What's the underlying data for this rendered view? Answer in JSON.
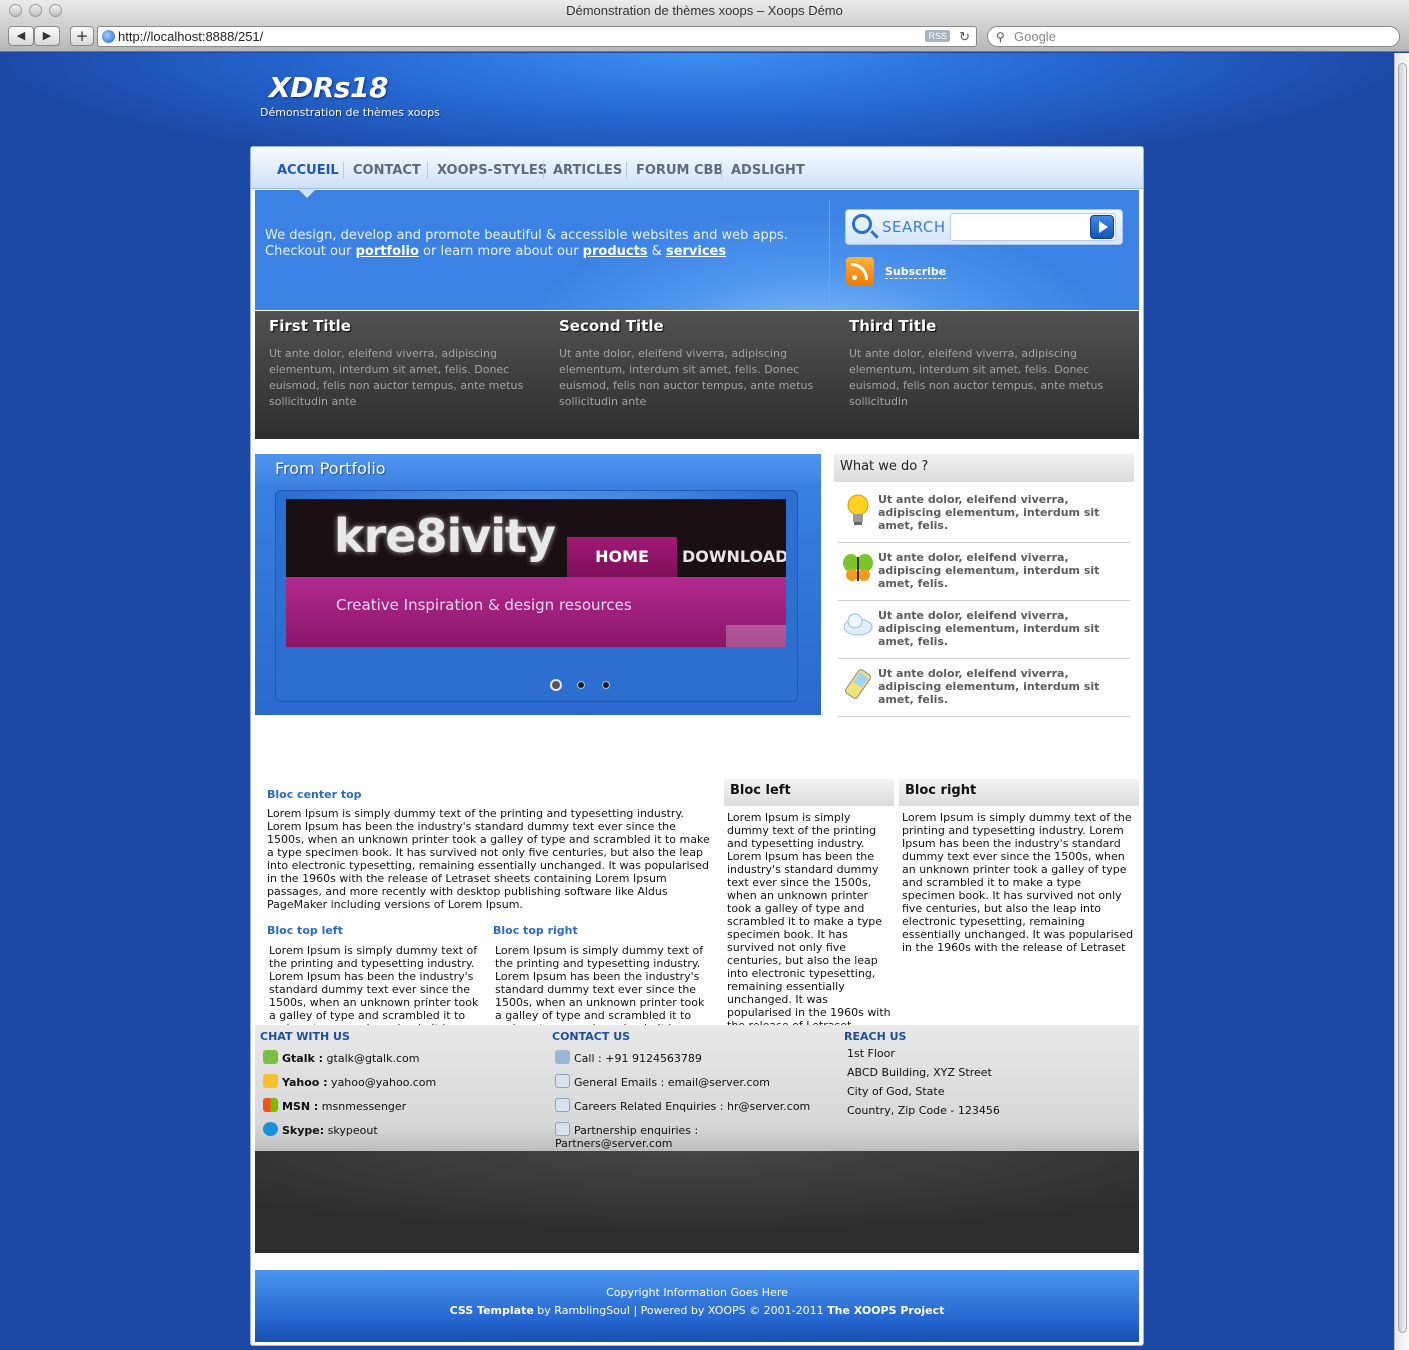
{
  "browser": {
    "title": "Démonstration de thèmes xoops – Xoops Démo",
    "url": "http://localhost:8888/251/",
    "rss": "RSS",
    "search_placeholder": "Google"
  },
  "site": {
    "logo": "XDRs18",
    "slogan": "Démonstration de thèmes xoops"
  },
  "nav": [
    "ACCUEIL",
    "CONTACT",
    "XOOPS-STYLES",
    "ARTICLES",
    "FORUM CBB",
    "ADSLIGHT"
  ],
  "hero": {
    "line1": "We design, develop and promote beautiful & accessible websites and web apps.",
    "line2_a": "Checkout our ",
    "link_portfolio": "portfolio",
    "line2_b": " or learn more about our ",
    "link_products": "products",
    "amp": " & ",
    "link_services": "services",
    "search_label": "SEARCH",
    "subscribe": "Subscribe"
  },
  "band": [
    {
      "title": "First Title",
      "text": "Ut ante dolor, eleifend viverra, adipiscing elementum, interdum sit amet, felis. Donec euismod, felis non auctor tempus, ante metus sollicitudin ante"
    },
    {
      "title": "Second Title",
      "text": "Ut ante dolor, eleifend viverra, adipiscing elementum, interdum sit amet, felis. Donec euismod, felis non auctor tempus, ante metus sollicitudin ante"
    },
    {
      "title": "Third Title",
      "text": "Ut ante dolor, eleifend viverra, adipiscing elementum, interdum sit amet, felis. Donec euismod, felis non auctor tempus, ante metus sollicitudin"
    }
  ],
  "portfolio": {
    "title": "From Portfolio",
    "brand": "kre8ivity",
    "home": "HOME",
    "downloads": "DOWNLOADS",
    "tagline": "Creative Inspiration & design resources"
  },
  "what_we_do": {
    "title": "What we do ?",
    "items": [
      {
        "icon": "lightbulb-icon",
        "text": "Ut ante dolor, eleifend viverra, adipiscing elementum, interdum sit amet, felis."
      },
      {
        "icon": "butterfly-icon",
        "text": "Ut ante dolor, eleifend viverra, adipiscing elementum, interdum sit amet, felis."
      },
      {
        "icon": "cloud-icon",
        "text": "Ut ante dolor, eleifend viverra, adipiscing elementum, interdum sit amet, felis."
      },
      {
        "icon": "phone-icon",
        "text": "Ut ante dolor, eleifend viverra, adipiscing elementum, interdum sit amet, felis."
      }
    ]
  },
  "blocks": {
    "center_top_title": "Bloc center top",
    "center_top_text": "Lorem Ipsum is simply dummy text of the printing and typesetting industry. Lorem Ipsum has been the industry's standard dummy text ever since the 1500s, when an unknown printer took a galley of type and scrambled it to make a type specimen book. It has survived not only five centuries, but also the leap into electronic typesetting, remaining essentially unchanged. It was popularised in the 1960s with the release of Letraset sheets containing Lorem Ipsum passages, and more recently with desktop publishing software like Aldus PageMaker including versions of Lorem Ipsum.",
    "top_left_title": "Bloc top left",
    "top_left_text": "Lorem Ipsum is simply dummy text of the printing and typesetting industry. Lorem Ipsum has been the industry's standard dummy text ever since the 1500s, when an unknown printer took a galley of type and scrambled it to make a type specimen book. It has survived not only five centuries, but also the leap into electronic typesetting, remaining",
    "top_right_title": "Bloc top right",
    "top_right_text": "Lorem Ipsum is simply dummy text of the printing and typesetting industry. Lorem Ipsum has been the industry's standard dummy text ever since the 1500s, when an unknown printer took a galley of type and scrambled it to make a type specimen book. It has survived not only five centuries,",
    "left_title": "Bloc left",
    "left_text": "Lorem Ipsum is simply dummy text of the printing and typesetting industry. Lorem Ipsum has been the industry's standard dummy text ever since the 1500s, when an unknown printer took a galley of type and scrambled it to make a type specimen book. It has survived not only five centuries, but also the leap into electronic typesetting, remaining essentially unchanged. It was popularised in the 1960s with the release of Letraset",
    "right_title": "Bloc right",
    "right_text": "Lorem Ipsum is simply dummy text of the printing and typesetting industry. Lorem Ipsum has been the industry's standard dummy text ever since the 1500s, when an unknown printer took a galley of type and scrambled it to make a type specimen book. It has survived not only five centuries, but also the leap into electronic typesetting, remaining essentially unchanged. It was popularised in the 1960s with the release of Letraset"
  },
  "contact_strip": {
    "chat_title": "CHAT WITH US",
    "chat": [
      {
        "label": "Gtalk :",
        "value": " gtalk@gtalk.com",
        "icon": "gtalk-icon"
      },
      {
        "label": "Yahoo :",
        "value": " yahoo@yahoo.com",
        "icon": "yahoo-icon"
      },
      {
        "label": "MSN :",
        "value": " msnmessenger",
        "icon": "msn-icon"
      },
      {
        "label": "Skype:",
        "value": " skypeout",
        "icon": "skype-icon"
      }
    ],
    "contact_title": "CONTACT US",
    "contact": [
      {
        "text": "Call : +91 9124563789",
        "icon": "phone-icon"
      },
      {
        "text": "General Emails : email@server.com",
        "icon": "mail-icon"
      },
      {
        "text": "Careers Related Enquiries : hr@server.com",
        "icon": "mail-icon"
      },
      {
        "text": "Partnership enquiries :",
        "text2": "Partners@server.com",
        "icon": "mail-icon"
      }
    ],
    "reach_title": "REACH US",
    "reach": [
      "1st Floor",
      "ABCD Building, XYZ Street",
      "City of God, State",
      "Country, Zip Code - 123456"
    ]
  },
  "footer": {
    "line1": "Copyright Information Goes Here",
    "css_template": "CSS Template",
    "by": " by RamblingSoul | Powered by XOOPS © 2001-2011 ",
    "project": "The XOOPS Project"
  }
}
